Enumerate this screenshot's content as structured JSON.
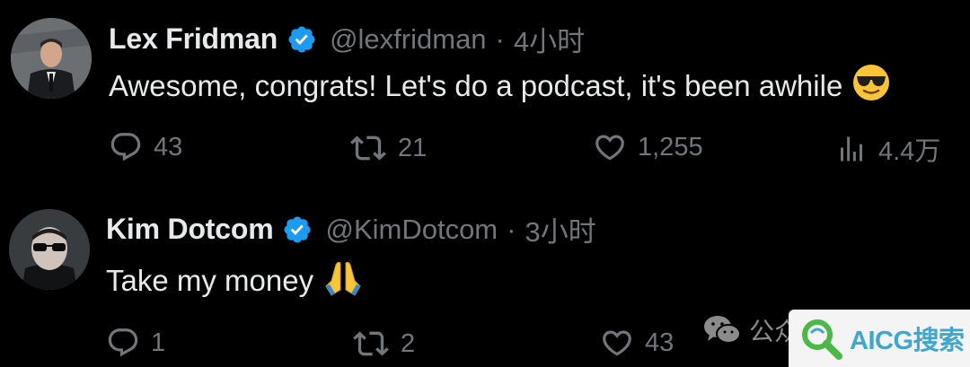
{
  "tweets": [
    {
      "author": "Lex Fridman",
      "handle": "@lexfridman",
      "separator": "·",
      "time": "4小时",
      "text": "Awesome, congrats! Let's do a podcast, it's been awhile",
      "emoji_icon": "sunglasses-emoji-icon",
      "replies": "43",
      "retweets": "21",
      "likes": "1,255",
      "views": "4.4万"
    },
    {
      "author": "Kim Dotcom",
      "handle": "@KimDotcom",
      "separator": "·",
      "time": "3小时",
      "text": "Take my money",
      "emoji_icon": "folded-hands-emoji-icon",
      "replies": "1",
      "retweets": "2",
      "likes": "43"
    }
  ],
  "overlay": {
    "wechat_label": "公众",
    "watermark_text": "AICG搜索"
  },
  "colors": {
    "background": "#000000",
    "text_primary": "#e7e9ea",
    "text_secondary": "#71767b",
    "verified_blue": "#1d9bf0",
    "watermark_accent": "#3fa6cf"
  }
}
